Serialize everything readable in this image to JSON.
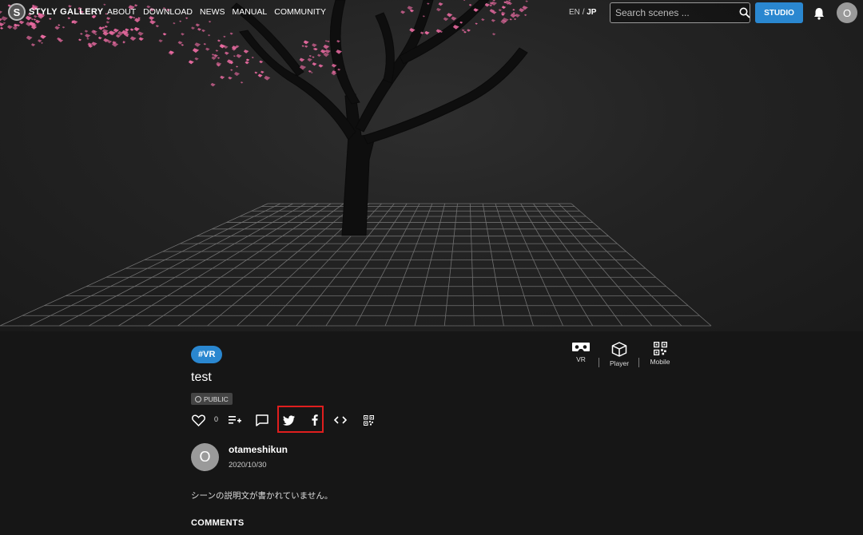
{
  "nav": {
    "logo_text": "STYLY GALLERY",
    "logo_letter": "S",
    "links": [
      "ABOUT",
      "DOWNLOAD",
      "NEWS",
      "MANUAL",
      "COMMUNITY"
    ],
    "lang_en": "EN",
    "lang_sep": "/",
    "lang_jp": "JP",
    "search_placeholder": "Search scenes ...",
    "studio_label": "STUDIO",
    "avatar_letter": "O"
  },
  "scene": {
    "tag": "#VR",
    "title": "test",
    "visibility": "PUBLIC",
    "like_count": "0",
    "modes": [
      {
        "label": "VR",
        "icon": "vr-headset-icon"
      },
      {
        "label": "Player",
        "icon": "cube-icon"
      },
      {
        "label": "Mobile",
        "icon": "qr-code-icon"
      }
    ],
    "actions": [
      "heart-icon",
      "playlist-add-icon",
      "comment-icon",
      "twitter-icon",
      "facebook-icon",
      "embed-code-icon",
      "qr-code-icon"
    ]
  },
  "author": {
    "avatar_letter": "O",
    "name": "otameshikun",
    "date": "2020/10/30"
  },
  "description": "シーンの説明文が書かれていません。",
  "comments_heading": "COMMENTS",
  "colors": {
    "accent": "#2a87d0",
    "highlight_box": "#e01e1e",
    "blossom": "#e86aa0"
  }
}
